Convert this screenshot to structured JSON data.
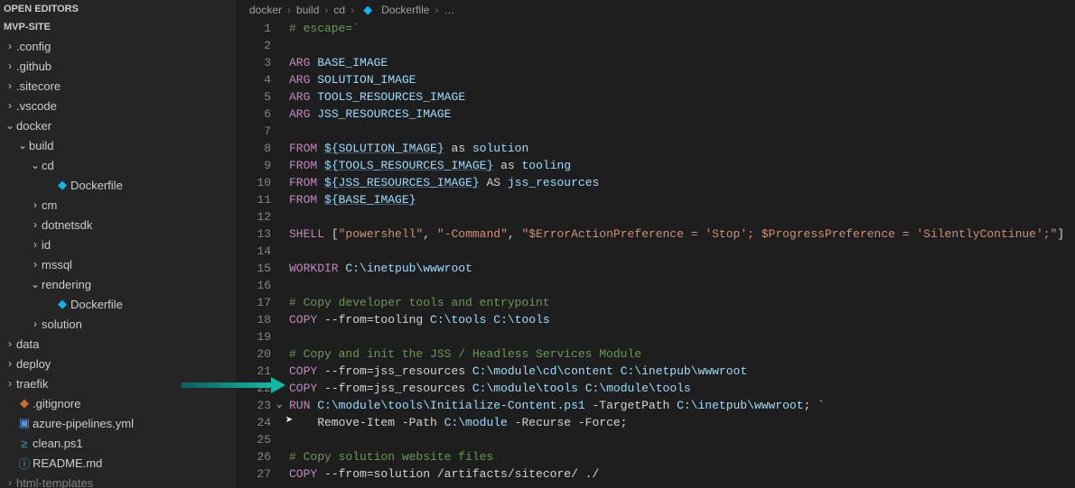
{
  "sidebar": {
    "section_open_editors": "OPEN EDITORS",
    "section_project": "MVP-SITE",
    "items": [
      {
        "kind": "folder",
        "open": false,
        "depth": 1,
        "label": ".config"
      },
      {
        "kind": "folder",
        "open": false,
        "depth": 1,
        "label": ".github"
      },
      {
        "kind": "folder",
        "open": false,
        "depth": 1,
        "label": ".sitecore"
      },
      {
        "kind": "folder",
        "open": false,
        "depth": 1,
        "label": ".vscode"
      },
      {
        "kind": "folder",
        "open": true,
        "depth": 1,
        "label": "docker"
      },
      {
        "kind": "folder",
        "open": true,
        "depth": 2,
        "label": "build"
      },
      {
        "kind": "folder",
        "open": true,
        "depth": 3,
        "label": "cd"
      },
      {
        "kind": "file",
        "icon": "docker",
        "depth": 4,
        "label": "Dockerfile"
      },
      {
        "kind": "folder",
        "open": false,
        "depth": 3,
        "label": "cm"
      },
      {
        "kind": "folder",
        "open": false,
        "depth": 3,
        "label": "dotnetsdk"
      },
      {
        "kind": "folder",
        "open": false,
        "depth": 3,
        "label": "id"
      },
      {
        "kind": "folder",
        "open": false,
        "depth": 3,
        "label": "mssql"
      },
      {
        "kind": "folder",
        "open": true,
        "depth": 3,
        "label": "rendering"
      },
      {
        "kind": "file",
        "icon": "docker",
        "depth": 4,
        "label": "Dockerfile"
      },
      {
        "kind": "folder",
        "open": false,
        "depth": 3,
        "label": "solution"
      },
      {
        "kind": "folder",
        "open": false,
        "depth": 1,
        "label": "data"
      },
      {
        "kind": "folder",
        "open": false,
        "depth": 1,
        "label": "deploy"
      },
      {
        "kind": "folder",
        "open": false,
        "depth": 1,
        "label": "traefik"
      },
      {
        "kind": "file",
        "icon": "git",
        "depth": 1,
        "label": ".gitignore"
      },
      {
        "kind": "file",
        "icon": "yml",
        "depth": 1,
        "label": "azure-pipelines.yml"
      },
      {
        "kind": "file",
        "icon": "ps1",
        "depth": 1,
        "label": "clean.ps1"
      },
      {
        "kind": "file",
        "icon": "info",
        "depth": 1,
        "label": "README.md"
      },
      {
        "kind": "folder",
        "open": false,
        "depth": 1,
        "label": "html-templates",
        "dim": true
      }
    ]
  },
  "breadcrumbs": {
    "p0": "docker",
    "p1": "build",
    "p2": "cd",
    "p3": "Dockerfile",
    "p4": "…"
  },
  "code": {
    "lines": [
      [
        {
          "k": "comment",
          "t": "# escape=`"
        }
      ],
      [],
      [
        {
          "k": "keyword",
          "t": "ARG"
        },
        {
          "k": "plain",
          "t": " "
        },
        {
          "k": "varplain",
          "t": "BASE_IMAGE"
        }
      ],
      [
        {
          "k": "keyword",
          "t": "ARG"
        },
        {
          "k": "plain",
          "t": " "
        },
        {
          "k": "varplain",
          "t": "SOLUTION_IMAGE"
        }
      ],
      [
        {
          "k": "keyword",
          "t": "ARG"
        },
        {
          "k": "plain",
          "t": " "
        },
        {
          "k": "varplain",
          "t": "TOOLS_RESOURCES_IMAGE"
        }
      ],
      [
        {
          "k": "keyword",
          "t": "ARG"
        },
        {
          "k": "plain",
          "t": " "
        },
        {
          "k": "varplain",
          "t": "JSS_RESOURCES_IMAGE"
        }
      ],
      [],
      [
        {
          "k": "keyword",
          "t": "FROM"
        },
        {
          "k": "plain",
          "t": " "
        },
        {
          "k": "var",
          "t": "${SOLUTION_IMAGE}"
        },
        {
          "k": "plain",
          "t": " as "
        },
        {
          "k": "varplain",
          "t": "solution"
        }
      ],
      [
        {
          "k": "keyword",
          "t": "FROM"
        },
        {
          "k": "plain",
          "t": " "
        },
        {
          "k": "var",
          "t": "${TOOLS_RESOURCES_IMAGE}"
        },
        {
          "k": "plain",
          "t": " as "
        },
        {
          "k": "varplain",
          "t": "tooling"
        }
      ],
      [
        {
          "k": "keyword",
          "t": "FROM"
        },
        {
          "k": "plain",
          "t": " "
        },
        {
          "k": "var",
          "t": "${JSS_RESOURCES_IMAGE}"
        },
        {
          "k": "plain",
          "t": " AS "
        },
        {
          "k": "varplain",
          "t": "jss_resources"
        }
      ],
      [
        {
          "k": "keyword",
          "t": "FROM"
        },
        {
          "k": "plain",
          "t": " "
        },
        {
          "k": "var",
          "t": "${BASE_IMAGE}"
        }
      ],
      [],
      [
        {
          "k": "keyword",
          "t": "SHELL"
        },
        {
          "k": "plain",
          "t": " ["
        },
        {
          "k": "string",
          "t": "\"powershell\""
        },
        {
          "k": "plain",
          "t": ", "
        },
        {
          "k": "string",
          "t": "\"-Command\""
        },
        {
          "k": "plain",
          "t": ", "
        },
        {
          "k": "string",
          "t": "\"$ErrorActionPreference = 'Stop'; $ProgressPreference = 'SilentlyContinue';\""
        },
        {
          "k": "plain",
          "t": "]"
        }
      ],
      [],
      [
        {
          "k": "keyword",
          "t": "WORKDIR"
        },
        {
          "k": "plain",
          "t": " "
        },
        {
          "k": "varplain",
          "t": "C:\\inetpub\\wwwroot"
        }
      ],
      [],
      [
        {
          "k": "comment",
          "t": "# Copy developer tools and entrypoint"
        }
      ],
      [
        {
          "k": "keyword",
          "t": "COPY"
        },
        {
          "k": "plain",
          "t": " --from=tooling "
        },
        {
          "k": "varplain",
          "t": "C:\\tools"
        },
        {
          "k": "plain",
          "t": " "
        },
        {
          "k": "varplain",
          "t": "C:\\tools"
        }
      ],
      [],
      [
        {
          "k": "comment",
          "t": "# Copy and init the JSS / Headless Services Module"
        }
      ],
      [
        {
          "k": "keyword",
          "t": "COPY"
        },
        {
          "k": "plain",
          "t": " --from=jss_resources "
        },
        {
          "k": "varplain",
          "t": "C:\\module\\cd\\content"
        },
        {
          "k": "plain",
          "t": " "
        },
        {
          "k": "varplain",
          "t": "C:\\inetpub\\wwwroot"
        }
      ],
      [
        {
          "k": "keyword",
          "t": "COPY"
        },
        {
          "k": "plain",
          "t": " --from=jss_resources "
        },
        {
          "k": "varplain",
          "t": "C:\\module\\tools"
        },
        {
          "k": "plain",
          "t": " "
        },
        {
          "k": "varplain",
          "t": "C:\\module\\tools"
        }
      ],
      [
        {
          "k": "keyword",
          "t": "RUN"
        },
        {
          "k": "plain",
          "t": " "
        },
        {
          "k": "varplain",
          "t": "C:\\module\\tools\\Initialize-Content.ps1"
        },
        {
          "k": "plain",
          "t": " -TargetPath "
        },
        {
          "k": "varplain",
          "t": "C:\\inetpub\\wwwroot"
        },
        {
          "k": "plain",
          "t": "; `"
        }
      ],
      [
        {
          "k": "plain",
          "t": "    Remove-Item -Path "
        },
        {
          "k": "varplain",
          "t": "C:\\module"
        },
        {
          "k": "plain",
          "t": " -Recurse -Force;"
        }
      ],
      [],
      [
        {
          "k": "comment",
          "t": "# Copy solution website files"
        }
      ],
      [
        {
          "k": "keyword",
          "t": "COPY"
        },
        {
          "k": "plain",
          "t": " --from=solution /artifacts/sitecore/ ./"
        }
      ]
    ]
  }
}
